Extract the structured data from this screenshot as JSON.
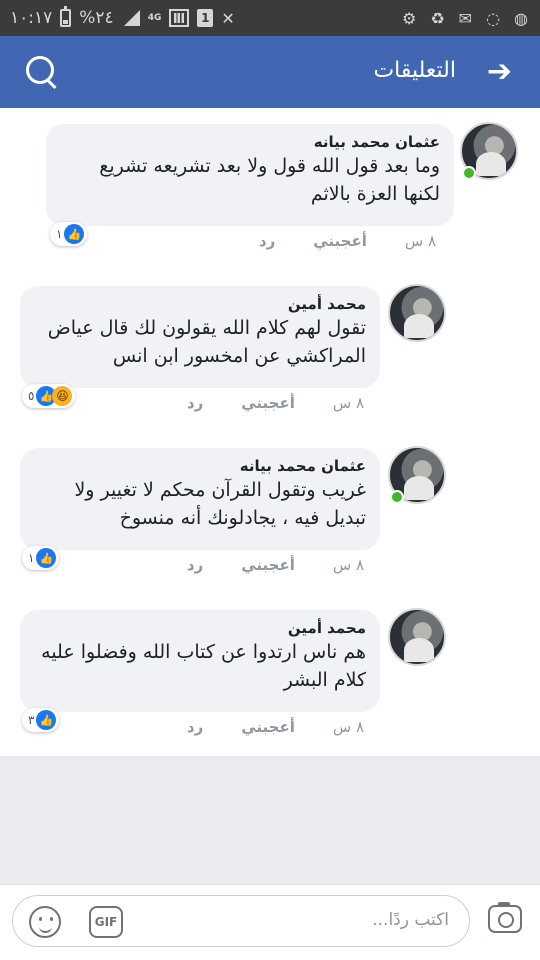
{
  "status_bar": {
    "time": "١٠:١٧",
    "battery_percent": "%٢٤",
    "network": "4G"
  },
  "header": {
    "title": "التعليقات"
  },
  "comments": [
    {
      "author": "عثمان محمد بيانه",
      "text": "وما بعد قول الله قول ولا بعد تشريعه تشريع لكنها العزة بالاثم",
      "time": "٨ س",
      "like_label": "أعجبني",
      "reply_label": "رد",
      "reaction_count": "١",
      "reactions": [
        "like"
      ],
      "online": true
    },
    {
      "author": "محمد أمين",
      "text": "تقول لهم كلام الله يقولون لك قال عياض المراكشي عن امخسور ابن انس",
      "time": "٨ س",
      "like_label": "أعجبني",
      "reply_label": "رد",
      "reaction_count": "٥",
      "reactions": [
        "like",
        "haha"
      ],
      "online": false
    },
    {
      "author": "عثمان محمد بيانه",
      "text": "غريب وتقول القرآن محكم لا تغيير ولا تبديل فيه ، يجادلونك أنه منسوخ",
      "time": "٨ س",
      "like_label": "أعجبني",
      "reply_label": "رد",
      "reaction_count": "١",
      "reactions": [
        "like"
      ],
      "online": true
    },
    {
      "author": "محمد أمين",
      "text": "هم ناس ارتدوا عن كتاب الله وفضلوا عليه كلام البشر",
      "time": "٨ س",
      "like_label": "أعجبني",
      "reply_label": "رد",
      "reaction_count": "٣",
      "reactions": [
        "like"
      ],
      "online": false
    }
  ],
  "composer": {
    "placeholder": "اكتب ردًا...",
    "gif_label": "GIF"
  },
  "colors": {
    "header": "#4267b2",
    "status_bar": "#3b3b3b",
    "bubble": "#f1f2f6",
    "like_blue": "#1877f2",
    "online_green": "#42b72a"
  }
}
